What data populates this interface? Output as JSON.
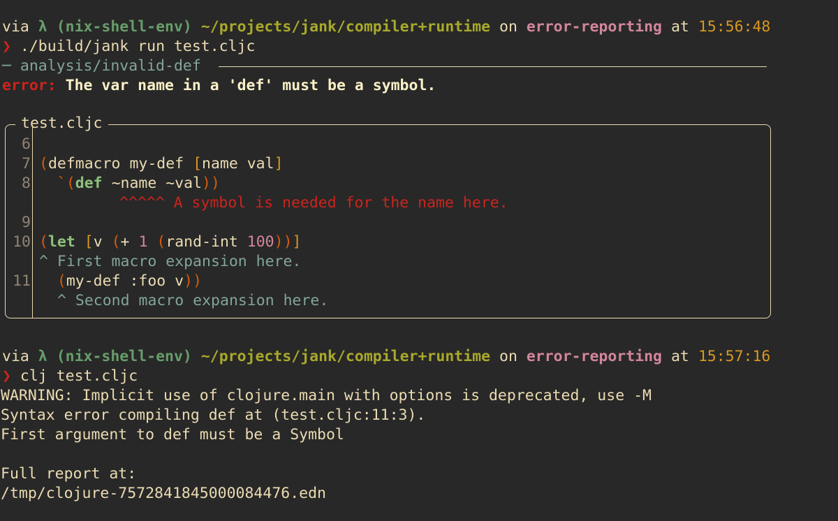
{
  "prompt1": {
    "via": "via",
    "lambda": "λ",
    "env": "(nix-shell-env)",
    "path": "~/projects/jank/compiler+runtime",
    "on": "on",
    "branch": "error-reporting",
    "at": "at",
    "time": "15:56:48",
    "arrow": "❯",
    "command": "./build/jank run test.cljc"
  },
  "jank_error": {
    "category": "analysis/invalid-def",
    "label": "error:",
    "message": "The var name in a 'def' must be a symbol.",
    "file": "test.cljc",
    "lines": [
      {
        "num": "6"
      },
      {
        "num": "7",
        "code": {
          "p1": "(",
          "kw": "defmacro my-def ",
          "b1": "[",
          "args": "name val",
          "b2": "]"
        }
      },
      {
        "num": "8",
        "code": {
          "indent": "  ",
          "q": "`(",
          "kw": "def",
          "rest": " ~name ~val",
          "close": "))"
        }
      },
      {
        "note": "^^^^^ A symbol is needed for the name here."
      },
      {
        "num": "9"
      },
      {
        "num": "10",
        "code": {
          "p1": "(",
          "kw": "let",
          "sp": " ",
          "b1": "[",
          "v": "v ",
          "p2": "(",
          "plus": "+ ",
          "one": "1",
          "sp2": " ",
          "p3": "(",
          "fn": "rand-int ",
          "hundred": "100",
          "close": "))",
          "b2": "]"
        }
      },
      {
        "note": "^ First macro expansion here."
      },
      {
        "num": "11",
        "code": {
          "indent": "  ",
          "p1": "(",
          "body": "my-def :foo v",
          "close": "))"
        }
      },
      {
        "note": "^ Second macro expansion here."
      }
    ]
  },
  "prompt2": {
    "via": "via",
    "lambda": "λ",
    "env": "(nix-shell-env)",
    "path": "~/projects/jank/compiler+runtime",
    "on": "on",
    "branch": "error-reporting",
    "at": "at",
    "time": "15:57:16",
    "arrow": "❯",
    "command": "clj test.cljc"
  },
  "clj_output": [
    "WARNING: Implicit use of clojure.main with options is deprecated, use -M",
    "Syntax error compiling def at (test.cljc:11:3).",
    "First argument to def must be a Symbol",
    "",
    "Full report at:",
    "/tmp/clojure-7572841845000084476.edn"
  ],
  "colors": {
    "background": "#282828",
    "foreground": "#ebdbb2",
    "error": "#cc241d",
    "env": "#689d6a",
    "path": "#a9a92b",
    "branch": "#d3869b",
    "time": "#d79921"
  }
}
